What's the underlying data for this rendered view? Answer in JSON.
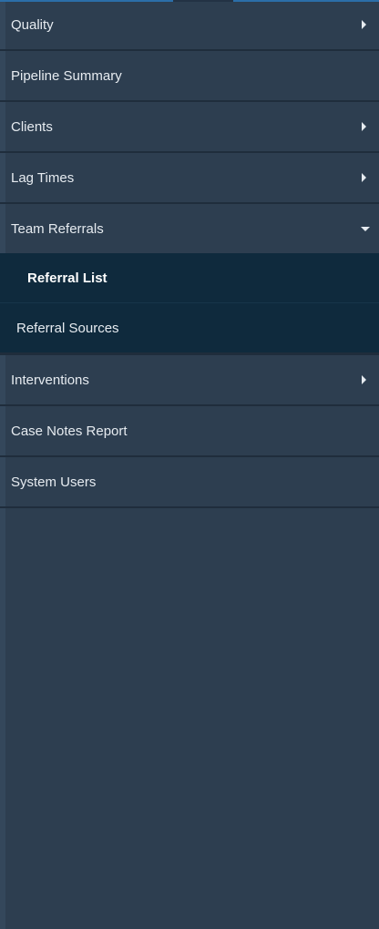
{
  "colors": {
    "sidebar_bg": "#2d3e50",
    "submenu_bg": "#0f2a3d",
    "divider": "#1f2d3c",
    "accent": "#2b6ea8",
    "text": "#e6ebf0"
  },
  "menu": {
    "items": [
      {
        "label": "Quality",
        "icon": "caret-right-icon"
      },
      {
        "label": "Pipeline Summary"
      },
      {
        "label": "Clients",
        "icon": "caret-right-icon"
      },
      {
        "label": "Lag Times",
        "icon": "caret-right-icon"
      },
      {
        "label": "Team Referrals",
        "icon": "caret-down-icon",
        "expanded": true,
        "children": [
          {
            "label": "Referral List",
            "active": true
          },
          {
            "label": "Referral Sources"
          }
        ]
      },
      {
        "label": "Interventions",
        "icon": "caret-right-icon"
      },
      {
        "label": "Case Notes Report"
      },
      {
        "label": "System Users"
      }
    ]
  }
}
